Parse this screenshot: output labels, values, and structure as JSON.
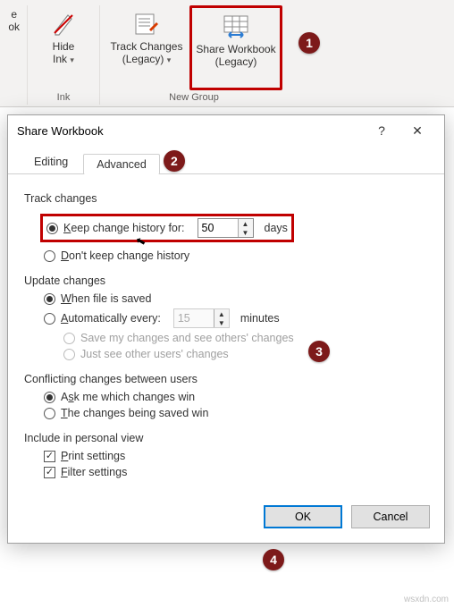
{
  "ribbon": {
    "btn0_l1": "e",
    "btn0_l2": "ok",
    "hide_l1": "Hide",
    "hide_l2": "Ink",
    "group_ink": "Ink",
    "track_l1": "Track Changes",
    "track_l2": "(Legacy)",
    "share_l1": "Share Workbook",
    "share_l2": "(Legacy)",
    "group_new": "New Group"
  },
  "dialog": {
    "title": "Share Workbook",
    "help": "?",
    "close": "✕",
    "tab_editing": "Editing",
    "tab_advanced": "Advanced",
    "track_title": "Track changes",
    "keep_prefix_u": "K",
    "keep_rest": "eep change history for:",
    "keep_value": "50",
    "days": "days",
    "dont_prefix_u": "D",
    "dont_rest": "on't keep change history",
    "update_title": "Update changes",
    "when_prefix_u": "W",
    "when_rest": "hen file is saved",
    "auto_prefix_u": "A",
    "auto_rest": "utomatically every:",
    "auto_value": "15",
    "minutes": "minutes",
    "save_mine": "Save my changes and see others' changes",
    "just_see": "Just see other users' changes",
    "conflict_title": "Conflicting changes between users",
    "ask_prefix_u": "s",
    "ask_before": "A",
    "ask_after": "k me which changes win",
    "being_prefix_u": "T",
    "being_rest": "he changes being saved win",
    "include_title": "Include in personal view",
    "print_prefix_u": "P",
    "print_rest": "rint settings",
    "filter_prefix_u": "F",
    "filter_rest": "ilter settings",
    "ok": "OK",
    "cancel": "Cancel"
  },
  "markers": {
    "m1": "1",
    "m2": "2",
    "m3": "3",
    "m4": "4"
  },
  "watermark": "wsxdn.com"
}
